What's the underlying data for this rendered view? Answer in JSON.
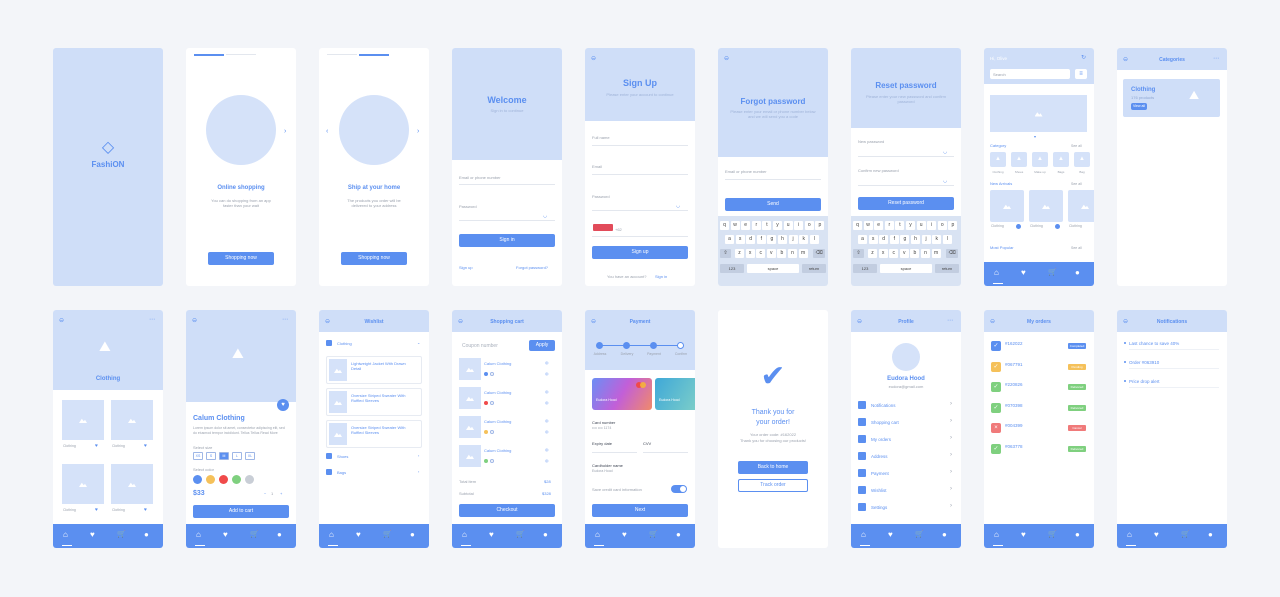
{
  "splash": {
    "brand": "FashiON"
  },
  "onboard1": {
    "title": "Online shopping",
    "desc": "You can do shopping from an app faster than your wait",
    "button": "Shopping now"
  },
  "onboard2": {
    "title": "Ship at your home",
    "desc": "The products you order will be delivered to your address",
    "button": "Shopping now"
  },
  "welcome": {
    "title": "Welcome",
    "subtitle": "Sign in to continue",
    "email_label": "Email or phone number",
    "password_label": "Password",
    "signin": "Sign in",
    "signup": "Sign up",
    "forgot": "Forgot password?"
  },
  "signup": {
    "title": "Sign Up",
    "subtitle": "Please enter your account to continue",
    "fullname": "Full name",
    "email": "Email",
    "password": "Password",
    "phone_code": "+62",
    "button": "Sign up",
    "footer_q": "You have an account?",
    "footer_link": "Sign in"
  },
  "forgot": {
    "title": "Forgot password",
    "desc": "Please enter your email or phone number below and we will send you a code",
    "label": "Email or phone number",
    "button": "Send"
  },
  "reset": {
    "title": "Reset password",
    "desc": "Please enter your new password and confirm password",
    "new_label": "New password",
    "confirm_label": "Confirm new password",
    "button": "Reset password"
  },
  "keyboard": {
    "row1": [
      "q",
      "w",
      "e",
      "r",
      "t",
      "y",
      "u",
      "i",
      "o",
      "p"
    ],
    "row2": [
      "a",
      "s",
      "d",
      "f",
      "g",
      "h",
      "j",
      "k",
      "l"
    ],
    "row3": [
      "z",
      "x",
      "c",
      "v",
      "b",
      "n",
      "m"
    ],
    "num": "123",
    "space": "space",
    "ret": "return"
  },
  "home": {
    "greeting": "Hi, Olive",
    "search": "Search",
    "category": "Category",
    "see_all": "See all",
    "cats": [
      "Clothing",
      "Shoes",
      "Make up",
      "Bags",
      "Bag"
    ],
    "new_arrivals": "New Arrivals",
    "products": [
      "Clothing",
      "Clothing",
      "Clothing"
    ],
    "most_popular": "Most Popular"
  },
  "categories": {
    "title": "Categories",
    "card_title": "Clothing",
    "card_sub": "176 products",
    "card_btn": "View all"
  },
  "cat_clothing": {
    "title": "Clothing",
    "items": [
      "Clothing",
      "Clothing",
      "Clothing",
      "Clothing"
    ]
  },
  "detail": {
    "title": "Calum Clothing",
    "desc": "Lorem ipsum dolor sit amet, consectetur adipiscing elit, sed do eiusmod tempor incididunt. Tellus Tellus Read More",
    "size_label": "Select size",
    "sizes": [
      "XS",
      "S",
      "M",
      "L",
      "XL"
    ],
    "color_label": "Select color",
    "price": "$33",
    "qty": "1",
    "button": "Add to cart"
  },
  "wishlist": {
    "title": "Wishlist",
    "section": "Clothing",
    "items": [
      "Lightweight Jacket With Drawn Detail",
      "Oversize Striped Sweater With Ruffled Sleeves",
      "Oversize Striped Sweater With Ruffled Sleeves"
    ],
    "shoes": "Shoes",
    "bags": "Bags"
  },
  "cart": {
    "title": "Shopping cart",
    "coupon": "Coupon number",
    "apply": "Apply",
    "items": [
      "Calum Clothing",
      "Calum Clothing",
      "Calum Clothing",
      "Calum Clothing"
    ],
    "subtotal_label": "Total item",
    "subtotal": "$28",
    "total_label": "Subtotal",
    "total": "$328",
    "button": "Checkout"
  },
  "payment": {
    "title": "Payment",
    "steps": [
      "Address",
      "Delivery",
      "Payment",
      "Confirm"
    ],
    "card_name": "Eudora Hood",
    "card_number_label": "Card number",
    "expiry_label": "Expiry date",
    "cvv_label": "CVV",
    "holder_label": "Cardholder name",
    "holder": "Eudora Hood",
    "save_label": "Save credit card information",
    "button": "Next"
  },
  "thanks": {
    "title1": "Thank you for",
    "title2": "your order!",
    "sub1": "Your order code: #162022",
    "sub2": "Thank you for choosing our products!",
    "home": "Back to home",
    "track": "Track order"
  },
  "profile": {
    "title": "Profile",
    "name": "Eudora Hood",
    "email": "eudora@gmail.com",
    "items": [
      "Notifications",
      "Shopping cart",
      "My orders",
      "Address",
      "Payment",
      "Wishlist",
      "Settings"
    ]
  },
  "orders": {
    "title": "My orders",
    "items": [
      {
        "code": "#162022",
        "status": "Completed",
        "color": "#5b8ff0"
      },
      {
        "code": "#067791",
        "status": "Pending",
        "color": "#f5c15a"
      },
      {
        "code": "#220826",
        "status": "Delivered",
        "color": "#7fd07f"
      },
      {
        "code": "#070398",
        "status": "Delivered",
        "color": "#7fd07f"
      },
      {
        "code": "#004399",
        "status": "Cancel",
        "color": "#f07a7a"
      },
      {
        "code": "#063778",
        "status": "Delivered",
        "color": "#7fd07f"
      }
    ]
  },
  "notifications": {
    "title": "Notifications",
    "items": [
      "Last chance to save 40%",
      "Order #063910",
      "Price drop alert"
    ]
  }
}
